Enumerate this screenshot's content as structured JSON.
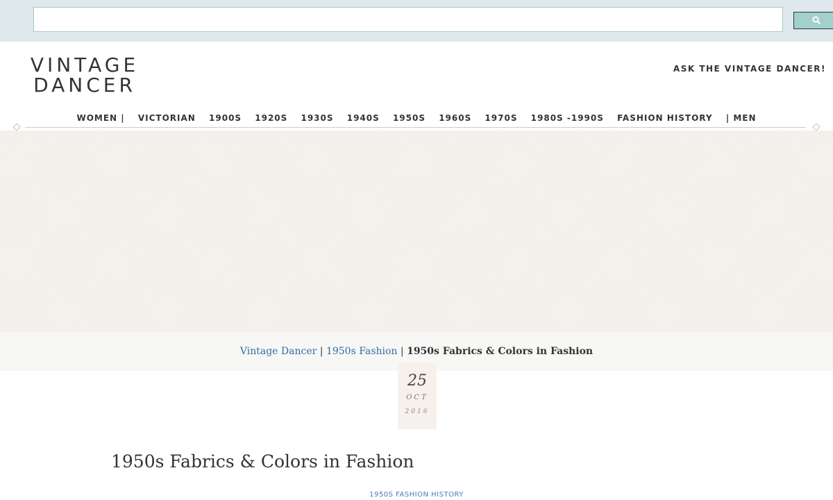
{
  "search": {
    "value": "",
    "placeholder": ""
  },
  "logo": {
    "line1": "VINTAGE",
    "line2": "DANCER"
  },
  "header": {
    "ask_label": "ASK THE VINTAGE DANCER!"
  },
  "nav": {
    "items": [
      {
        "label": "WOMEN |"
      },
      {
        "label": "VICTORIAN"
      },
      {
        "label": "1900S"
      },
      {
        "label": "1920S"
      },
      {
        "label": "1930S"
      },
      {
        "label": "1940S"
      },
      {
        "label": "1950S"
      },
      {
        "label": "1960S"
      },
      {
        "label": "1970S"
      },
      {
        "label": "1980S -1990S"
      },
      {
        "label": "FASHION HISTORY"
      },
      {
        "label": "| MEN"
      }
    ]
  },
  "breadcrumb": {
    "home": "Vintage Dancer",
    "sep1": " | ",
    "section": "1950s Fashion",
    "sep2": " | ",
    "current": "1950s Fabrics & Colors in Fashion"
  },
  "post": {
    "day": "25",
    "month": "OCT",
    "year": "2016",
    "title": "1950s Fabrics & Colors in Fashion",
    "category": "1950S FASHION HISTORY"
  },
  "colors": {
    "link": "#2e6da4",
    "search_button": "#a3cfcf",
    "hero_bg": "#f7f3ee"
  }
}
